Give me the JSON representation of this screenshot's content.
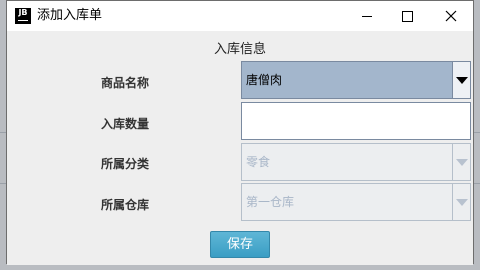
{
  "window": {
    "icon_text": "JB",
    "title": "添加入库单"
  },
  "form": {
    "section_title": "入库信息",
    "fields": [
      {
        "label": "商品名称",
        "value": "唐僧肉",
        "type": "combo",
        "enabled": true
      },
      {
        "label": "入库数量",
        "value": "",
        "type": "text",
        "enabled": true
      },
      {
        "label": "所属分类",
        "value": "零食",
        "type": "combo",
        "enabled": false
      },
      {
        "label": "所属仓库",
        "value": "第一仓库",
        "type": "combo",
        "enabled": false
      }
    ],
    "save_label": "保存"
  },
  "colors": {
    "selected_combo": "#a3b6cc",
    "save_button": "#3a9ec4",
    "disabled_text": "#a8b6c8"
  }
}
